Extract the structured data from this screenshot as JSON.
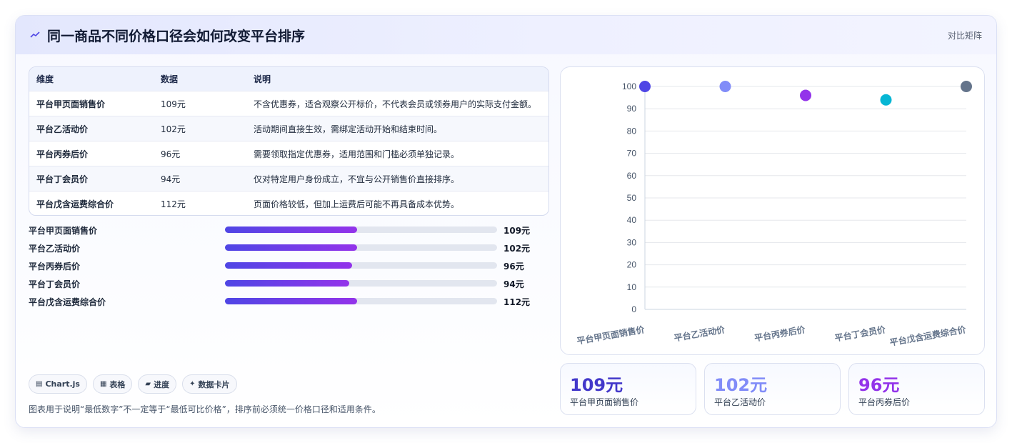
{
  "header": {
    "title": "同一商品不同价格口径会如何改变平台排序",
    "tag": "对比矩阵"
  },
  "table": {
    "columns": [
      "维度",
      "数据",
      "说明"
    ],
    "rows": [
      [
        "平台甲页面销售价",
        "109元",
        "不含优惠券，适合观察公开标价，不代表会员或领券用户的实际支付金额。"
      ],
      [
        "平台乙活动价",
        "102元",
        "活动期间直接生效，需绑定活动开始和结束时间。"
      ],
      [
        "平台丙券后价",
        "96元",
        "需要领取指定优惠券，适用范围和门槛必须单独记录。"
      ],
      [
        "平台丁会员价",
        "94元",
        "仅对特定用户身份成立，不宜与公开销售价直接排序。"
      ],
      [
        "平台戊含运费综合价",
        "112元",
        "页面价格较低，但加上运费后可能不再具备成本优势。"
      ]
    ]
  },
  "progress": {
    "items": [
      {
        "label": "平台甲页面销售价",
        "value": 109,
        "display": "109元",
        "fraction": 0.486
      },
      {
        "label": "平台乙活动价",
        "value": 102,
        "display": "102元",
        "fraction": 0.486
      },
      {
        "label": "平台丙券后价",
        "value": 96,
        "display": "96元",
        "fraction": 0.468
      },
      {
        "label": "平台丁会员价",
        "value": 94,
        "display": "94元",
        "fraction": 0.457
      },
      {
        "label": "平台戊含运费综合价",
        "value": 112,
        "display": "112元",
        "fraction": 0.486
      }
    ]
  },
  "chips": [
    {
      "icon": "chart-icon",
      "glyph": "▤",
      "label": "Chart.js"
    },
    {
      "icon": "table-icon",
      "glyph": "▦",
      "label": "表格"
    },
    {
      "icon": "progress-icon",
      "glyph": "▰",
      "label": "进度"
    },
    {
      "icon": "data-card-icon",
      "glyph": "✦",
      "label": "数据卡片"
    }
  ],
  "footnote": "图表用于说明“最低数字”不一定等于“最低可比价格”，排序前必须统一价格口径和适用条件。",
  "chart_data": {
    "type": "scatter",
    "categories": [
      "平台甲页面销售价",
      "平台乙活动价",
      "平台丙券后价",
      "平台丁会员价",
      "平台戊含运费综合价"
    ],
    "values": [
      109,
      102,
      96,
      94,
      112
    ],
    "colors": [
      "#4f46e5",
      "#818cf8",
      "#9333ea",
      "#06b6d4",
      "#64748b"
    ],
    "ylim": [
      0,
      100
    ],
    "yticks": [
      0,
      10,
      20,
      30,
      40,
      50,
      60,
      70,
      80,
      90,
      100
    ],
    "grid": true,
    "clipped": true,
    "title": "",
    "xlabel": "",
    "ylabel": ""
  },
  "stats": [
    {
      "value": "109元",
      "label": "平台甲页面销售价",
      "color": "#4338ca"
    },
    {
      "value": "102元",
      "label": "平台乙活动价",
      "color": "#818cf8"
    },
    {
      "value": "96元",
      "label": "平台丙券后价",
      "color": "#9333ea"
    }
  ]
}
